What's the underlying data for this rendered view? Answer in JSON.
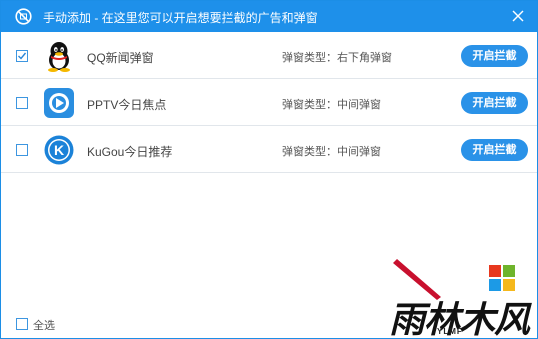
{
  "titlebar": {
    "title": "手动添加 - 在这里您可以开启想要拦截的广告和弹窗",
    "icon": "no-entry-icon",
    "close_icon": "close-icon"
  },
  "rows": [
    {
      "checked": true,
      "icon": "qq-penguin-icon",
      "name": "QQ新闻弹窗",
      "type": "弹窗类型：右下角弹窗",
      "button": "开启拦截"
    },
    {
      "checked": false,
      "icon": "pptv-icon",
      "name": "PPTV今日焦点",
      "type": "弹窗类型：中间弹窗",
      "button": "开启拦截"
    },
    {
      "checked": false,
      "icon": "kugou-icon",
      "name": "KuGou今日推荐",
      "type": "弹窗类型：中间弹窗",
      "button": "开启拦截"
    }
  ],
  "footer": {
    "select_all": "全选"
  },
  "watermark": {
    "text": "雨林木风",
    "sub": "YLMF"
  },
  "colors": {
    "accent": "#1e90ea",
    "button": "#2a92e8",
    "divider": "#e1e6eb"
  }
}
